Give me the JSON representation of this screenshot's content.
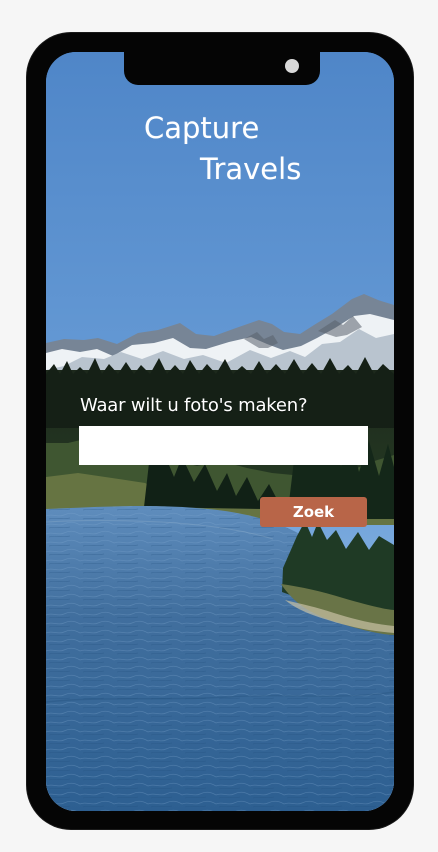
{
  "app": {
    "title_line_1": "Capture",
    "title_line_2": "Travels"
  },
  "search": {
    "prompt": "Waar wilt u foto's maken?",
    "value": "",
    "placeholder": "",
    "button_label": "Zoek"
  },
  "colors": {
    "button": "#b86548",
    "text": "#ffffff",
    "device": "#050505",
    "sky": "#4f85c7"
  },
  "icons": {
    "camera": "front-camera-icon"
  }
}
